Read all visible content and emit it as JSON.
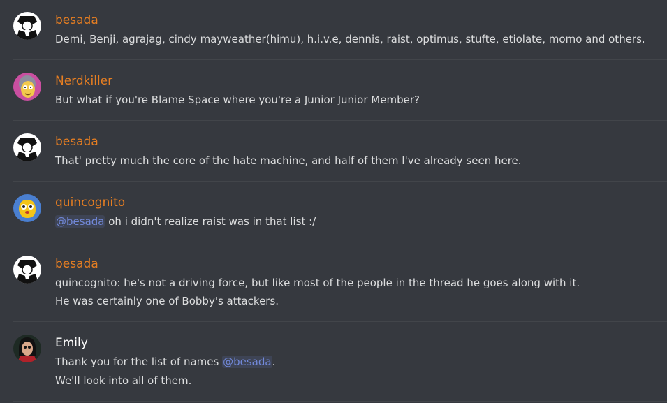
{
  "colors": {
    "background": "#36393f",
    "username_orange": "#e67e22",
    "username_white": "#ffffff",
    "text": "#dcddde",
    "mention": "#7289da"
  },
  "messages": [
    {
      "author": "besada",
      "avatar_icon": "bw-character-avatar",
      "lines": [
        "Demi, Benji, agrajag, cindy mayweather(himu), h.i.v.e, dennis, raist, optimus, stufte, etiolate, momo and others."
      ]
    },
    {
      "author": "Nerdkiller",
      "avatar_icon": "cartoon-face-avatar",
      "lines": [
        "But what if you're Blame Space where you're a Junior Junior Member?"
      ]
    },
    {
      "author": "besada",
      "avatar_icon": "bw-character-avatar",
      "lines": [
        "That' pretty much the core of the hate machine, and half of them I've already seen here."
      ]
    },
    {
      "author": "quincognito",
      "avatar_icon": "yellow-blob-avatar",
      "mention": "@besada",
      "lines": [
        " oh i didn't realize raist was in that list :/"
      ]
    },
    {
      "author": "besada",
      "avatar_icon": "bw-character-avatar",
      "lines": [
        "quincognito: he's not a driving force, but like most of the people in the thread he goes along with it.",
        "He was certainly one of Bobby's attackers."
      ]
    },
    {
      "author": "Emily",
      "avatar_icon": "doll-avatar",
      "lines_pre": "Thank you for the list of names ",
      "mention": "@besada",
      "lines_post": ".",
      "lines": [
        "We'll look into all of them."
      ]
    }
  ]
}
